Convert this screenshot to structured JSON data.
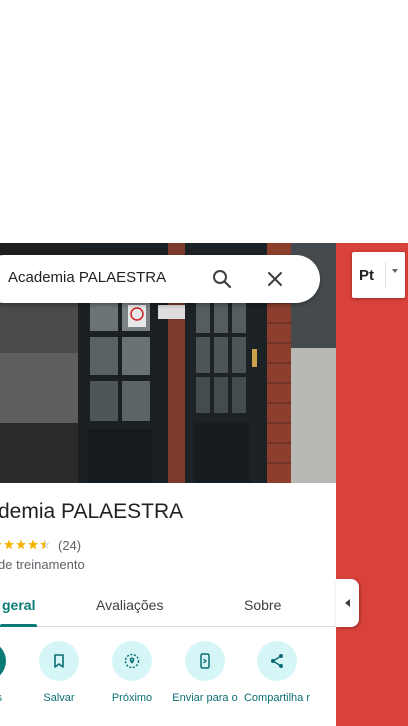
{
  "search": {
    "query": "Academia PALAESTRA"
  },
  "place": {
    "title_visible": "demia PALAESTRA",
    "rating_stars": 4.5,
    "review_count": "(24)",
    "category": "de treinamento"
  },
  "tabs": [
    {
      "label": "geral",
      "active": true
    },
    {
      "label": "Avaliações",
      "active": false
    },
    {
      "label": "Sobre",
      "active": false
    }
  ],
  "actions": [
    {
      "label": "s",
      "icon": "directions-icon"
    },
    {
      "label": "Salvar",
      "icon": "bookmark-icon"
    },
    {
      "label": "Próximo",
      "icon": "nearby-icon"
    },
    {
      "label": "Enviar para o",
      "icon": "send-to-phone-icon"
    },
    {
      "label": "Compartilha r",
      "icon": "share-icon"
    }
  ],
  "layer_button": {
    "label": "Pt"
  },
  "colors": {
    "accent": "#0b7a75",
    "action_bg": "#d6f5f7",
    "map_red": "#d8423a",
    "star": "#f5b400"
  }
}
